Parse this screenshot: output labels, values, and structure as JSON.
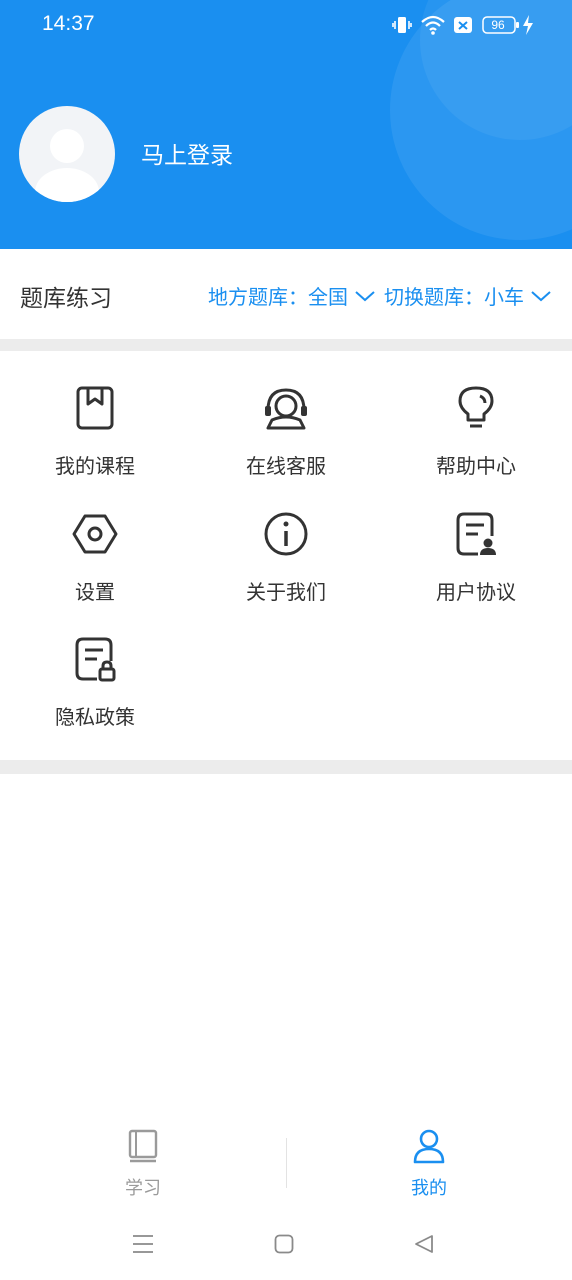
{
  "status_bar": {
    "time": "14:37",
    "battery": "96"
  },
  "profile": {
    "login_text": "马上登录"
  },
  "question_bank": {
    "title": "题库练习",
    "region_label": "地方题库：全国",
    "switch_label": "切换题库：小车"
  },
  "menu": [
    {
      "label": "我的课程",
      "icon": "book-icon"
    },
    {
      "label": "在线客服",
      "icon": "headset-icon"
    },
    {
      "label": "帮助中心",
      "icon": "lightbulb-icon"
    },
    {
      "label": "设置",
      "icon": "hexagon-settings-icon"
    },
    {
      "label": "关于我们",
      "icon": "info-icon"
    },
    {
      "label": "用户协议",
      "icon": "document-user-icon"
    },
    {
      "label": "隐私政策",
      "icon": "document-lock-icon"
    }
  ],
  "tabs": [
    {
      "label": "学习",
      "icon": "study-book-icon",
      "active": false
    },
    {
      "label": "我的",
      "icon": "person-icon",
      "active": true
    }
  ],
  "colors": {
    "primary": "#1a8ff0",
    "text": "#333333",
    "inactive": "#9a9a9a"
  }
}
